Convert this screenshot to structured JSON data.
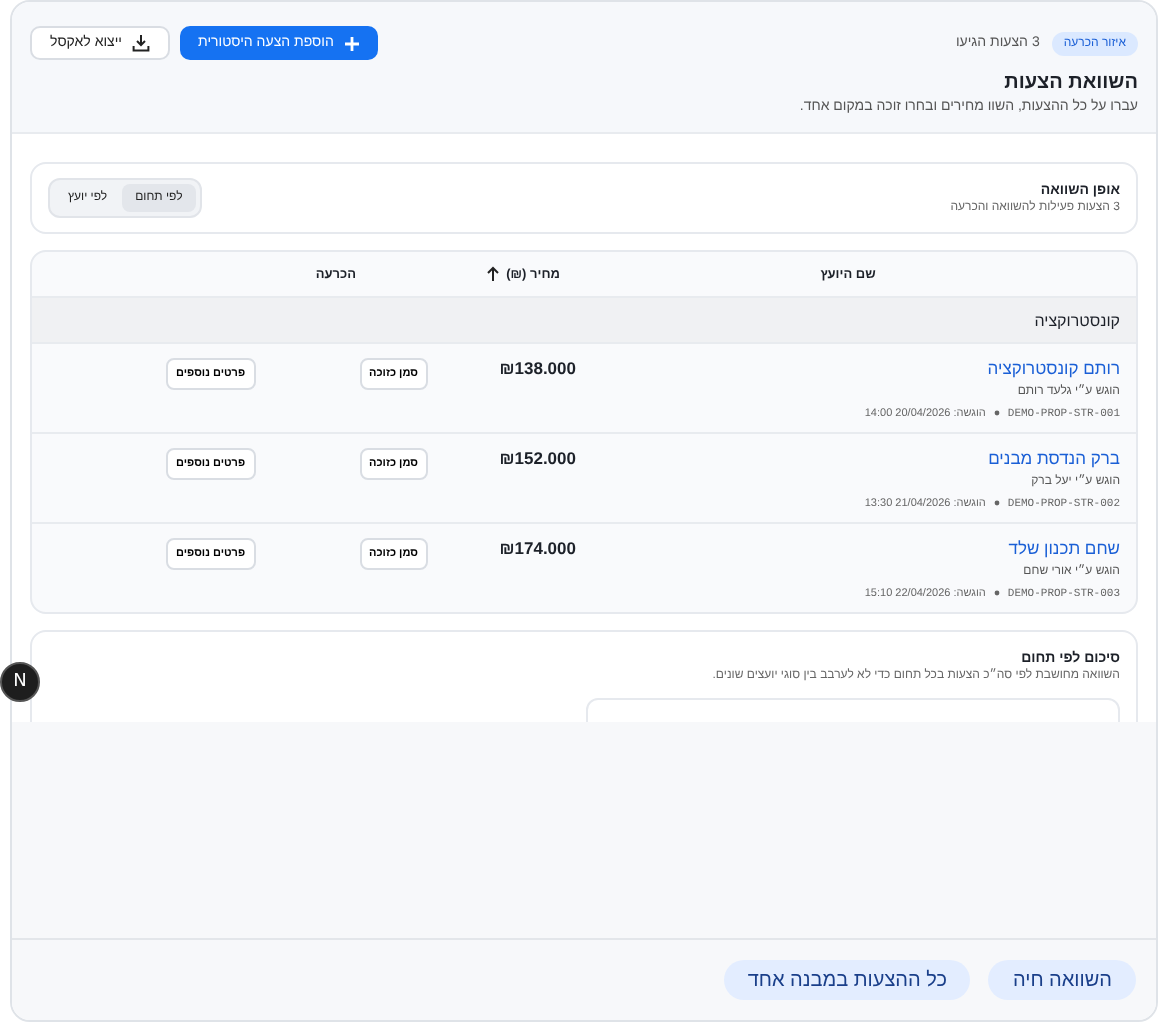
{
  "header": {
    "badge": "איזור הכרעה",
    "count": "3 הצעות הגיעו",
    "title": "השוואת הצעות",
    "subtitle": "עברו על כל ההצעות, השוו מחירים ובחרו זוכה במקום אחד.",
    "actions": [
      {
        "label": "הוספת הצעה היסטורית",
        "kind": "primary"
      },
      {
        "label": "ייצוא לאקסל",
        "kind": "export"
      }
    ]
  },
  "mode": {
    "title": "אופן השוואה",
    "subtitle": "3 הצעות פעילות להשוואה והכרעה",
    "options": [
      {
        "label": "לפי תחום",
        "selected": true
      },
      {
        "label": "לפי יועץ",
        "selected": false
      }
    ]
  },
  "table": {
    "columns": [
      {
        "label": "שם היועץ",
        "sorted": false
      },
      {
        "label": "מחיר (₪)",
        "sorted": true
      },
      {
        "label": "הכרעה",
        "sorted": false
      }
    ],
    "group": "קונסטרוקציה",
    "rows": [
      {
        "name": "רותם קונסטרוקציה",
        "by": "הוגש ע״י גלעד רותם",
        "code": "DEMO-PROP-STR-001",
        "submitted": "הוגשה: 20/04/2026 14:00",
        "price": "₪138.000",
        "win": "סמן כזוכה",
        "details": "פרטים נוספים"
      },
      {
        "name": "ברק הנדסת מבנים",
        "by": "הוגש ע״י יעל ברק",
        "code": "DEMO-PROP-STR-002",
        "submitted": "הוגשה: 21/04/2026 13:30",
        "price": "₪152.000",
        "win": "סמן כזוכה",
        "details": "פרטים נוספים"
      },
      {
        "name": "שחם תכנון שלד",
        "by": "הוגש ע״י אורי שחם",
        "code": "DEMO-PROP-STR-003",
        "submitted": "הוגשה: 22/04/2026 15:10",
        "price": "₪174.000",
        "win": "סמן כזוכה",
        "details": "פרטים נוספים"
      }
    ]
  },
  "summary": {
    "title": "סיכום לפי תחום",
    "subtitle": "השוואה מחושבת לפי סה״כ הצעות בכל תחום כדי לא לערבב בין סוגי יועצים שונים."
  },
  "dev_badge": "N",
  "footer": {
    "buttons": [
      "השוואה חיה",
      "כל ההצעות במבנה אחד"
    ]
  }
}
